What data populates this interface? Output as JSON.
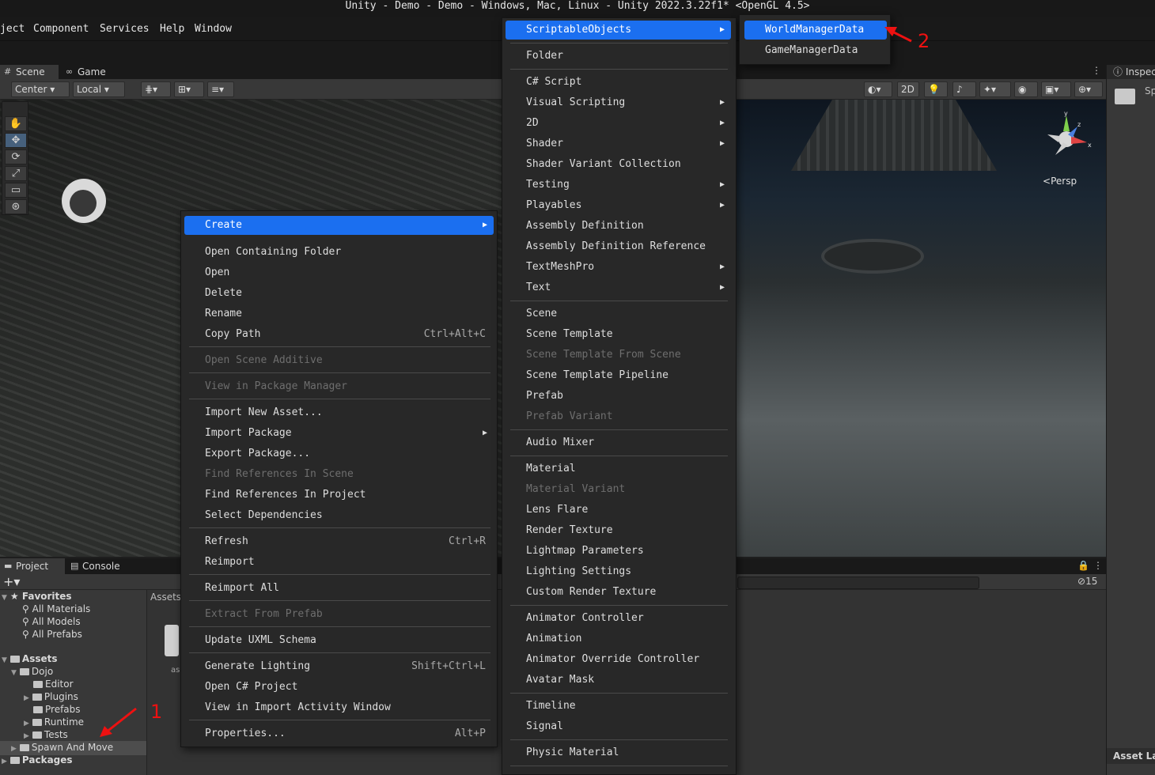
{
  "window": {
    "title": "Unity - Demo - Demo - Windows, Mac, Linux - Unity 2022.3.22f1* <OpenGL 4.5>"
  },
  "menubar": {
    "items": [
      "ject",
      "Component",
      "Services",
      "Help",
      "Window"
    ]
  },
  "scene": {
    "tabs": [
      "Scene",
      "Game"
    ],
    "pivot": "Center",
    "space": "Local",
    "mode_2d": "2D",
    "persp": "Persp",
    "gizmo_axes": [
      "y",
      "z",
      "x"
    ]
  },
  "inspector": {
    "tab": "Inspector",
    "item": "Sp",
    "asset_label": "Asset Labels"
  },
  "project": {
    "tabs": [
      "Project",
      "Console"
    ],
    "breadcrumb": "Assets",
    "hidden_count": "15",
    "tree": {
      "favorites": "Favorites",
      "fav_items": [
        "All Materials",
        "All Models",
        "All Prefabs"
      ],
      "assets": "Assets",
      "dojo": "Dojo",
      "dojo_items": [
        "Editor",
        "Plugins",
        "Prefabs",
        "Runtime",
        "Tests"
      ],
      "spawn": "Spawn And Move",
      "packages": "Packages"
    },
    "asset_caption": "as"
  },
  "context_menu": {
    "items": [
      {
        "label": "Create",
        "submenu": true,
        "highlighted": true
      },
      {
        "label": "Open Containing Folder"
      },
      {
        "label": "Open"
      },
      {
        "label": "Delete"
      },
      {
        "label": "Rename"
      },
      {
        "label": "Copy Path",
        "shortcut": "Ctrl+Alt+C"
      },
      {
        "label": "Open Scene Additive",
        "disabled": true
      },
      {
        "label": "View in Package Manager",
        "disabled": true
      },
      {
        "label": "Import New Asset..."
      },
      {
        "label": "Import Package",
        "submenu": true
      },
      {
        "label": "Export Package..."
      },
      {
        "label": "Find References In Scene",
        "disabled": true
      },
      {
        "label": "Find References In Project"
      },
      {
        "label": "Select Dependencies"
      },
      {
        "label": "Refresh",
        "shortcut": "Ctrl+R"
      },
      {
        "label": "Reimport"
      },
      {
        "label": "Reimport All"
      },
      {
        "label": "Extract From Prefab",
        "disabled": true
      },
      {
        "label": "Update UXML Schema"
      },
      {
        "label": "Generate Lighting",
        "shortcut": "Shift+Ctrl+L"
      },
      {
        "label": "Open C# Project"
      },
      {
        "label": "View in Import Activity Window"
      },
      {
        "label": "Properties...",
        "shortcut": "Alt+P"
      }
    ]
  },
  "create_menu": {
    "items": [
      {
        "label": "ScriptableObjects",
        "submenu": true,
        "highlighted": true
      },
      {
        "label": "Folder"
      },
      {
        "label": "C# Script"
      },
      {
        "label": "Visual Scripting",
        "submenu": true
      },
      {
        "label": "2D",
        "submenu": true
      },
      {
        "label": "Shader",
        "submenu": true
      },
      {
        "label": "Shader Variant Collection"
      },
      {
        "label": "Testing",
        "submenu": true
      },
      {
        "label": "Playables",
        "submenu": true
      },
      {
        "label": "Assembly Definition"
      },
      {
        "label": "Assembly Definition Reference"
      },
      {
        "label": "TextMeshPro",
        "submenu": true
      },
      {
        "label": "Text",
        "submenu": true
      },
      {
        "label": "Scene"
      },
      {
        "label": "Scene Template"
      },
      {
        "label": "Scene Template From Scene",
        "disabled": true
      },
      {
        "label": "Scene Template Pipeline"
      },
      {
        "label": "Prefab"
      },
      {
        "label": "Prefab Variant",
        "disabled": true
      },
      {
        "label": "Audio Mixer"
      },
      {
        "label": "Material"
      },
      {
        "label": "Material Variant",
        "disabled": true
      },
      {
        "label": "Lens Flare"
      },
      {
        "label": "Render Texture"
      },
      {
        "label": "Lightmap Parameters"
      },
      {
        "label": "Lighting Settings"
      },
      {
        "label": "Custom Render Texture"
      },
      {
        "label": "Animator Controller"
      },
      {
        "label": "Animation"
      },
      {
        "label": "Animator Override Controller"
      },
      {
        "label": "Avatar Mask"
      },
      {
        "label": "Timeline"
      },
      {
        "label": "Signal"
      },
      {
        "label": "Physic Material"
      }
    ]
  },
  "scriptable_menu": {
    "items": [
      {
        "label": "WorldManagerData",
        "highlighted": true
      },
      {
        "label": "GameManagerData"
      }
    ]
  },
  "annotations": {
    "one": "1",
    "two": "2",
    "color": "#ee1111"
  },
  "colors": {
    "highlight": "#1b6ff0",
    "menu_bg": "#282828",
    "panel_bg": "#383838"
  }
}
